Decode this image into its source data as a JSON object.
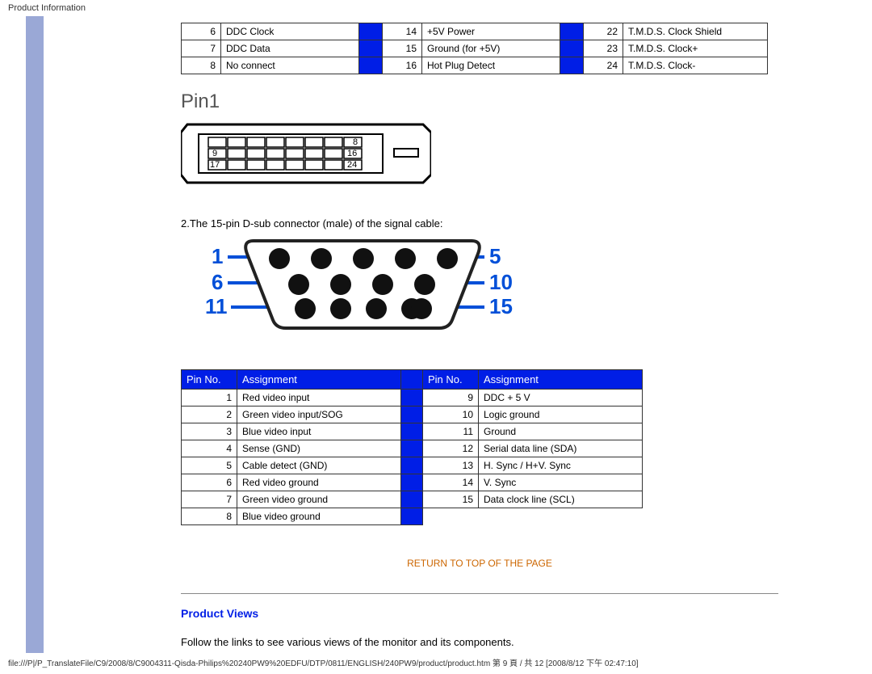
{
  "header": "Product Information",
  "dvi_rows": [
    [
      "6",
      "DDC Clock",
      "14",
      "+5V Power",
      "22",
      "T.M.D.S. Clock Shield"
    ],
    [
      "7",
      "DDC Data",
      "15",
      "Ground (for +5V)",
      "23",
      "T.M.D.S. Clock+"
    ],
    [
      "8",
      "No connect",
      "16",
      "Hot Plug Detect",
      "24",
      "T.M.D.S. Clock-"
    ]
  ],
  "pin1_label": "Pin1",
  "dvi_diagram_labels": {
    "l1": "9",
    "l2": "17",
    "r1": "8",
    "r2": "16",
    "r3": "24"
  },
  "para2": "2.The 15-pin D-sub connector (male) of the signal cable:",
  "vga_labels": {
    "l1": "1",
    "l2": "6",
    "l3": "11",
    "r1": "5",
    "r2": "10",
    "r3": "15"
  },
  "pin_headers": [
    "Pin No.",
    "Assignment",
    "Pin No.",
    "Assignment"
  ],
  "pin_rows": [
    [
      "1",
      "Red video input",
      "9",
      "DDC + 5 V"
    ],
    [
      "2",
      "Green video input/SOG",
      "10",
      "Logic ground"
    ],
    [
      "3",
      "Blue video input",
      "11",
      "Ground"
    ],
    [
      "4",
      "Sense (GND)",
      "12",
      "Serial data line (SDA)"
    ],
    [
      "5",
      "Cable detect (GND)",
      "13",
      "H. Sync / H+V. Sync"
    ],
    [
      "6",
      "Red video ground",
      "14",
      "V. Sync"
    ],
    [
      "7",
      "Green video ground",
      "15",
      "Data clock line (SCL)"
    ],
    [
      "8",
      "Blue video ground",
      "",
      ""
    ]
  ],
  "return_link": "RETURN TO TOP OF THE PAGE",
  "section_title": "Product Views",
  "follow_text": "Follow the links to see various views of the monitor and its components.",
  "footer": "file:///P|/P_TranslateFile/C9/2008/8/C9004311-Qisda-Philips%20240PW9%20EDFU/DTP/0811/ENGLISH/240PW9/product/product.htm 第 9 頁 / 共 12 [2008/8/12 下午 02:47:10]"
}
